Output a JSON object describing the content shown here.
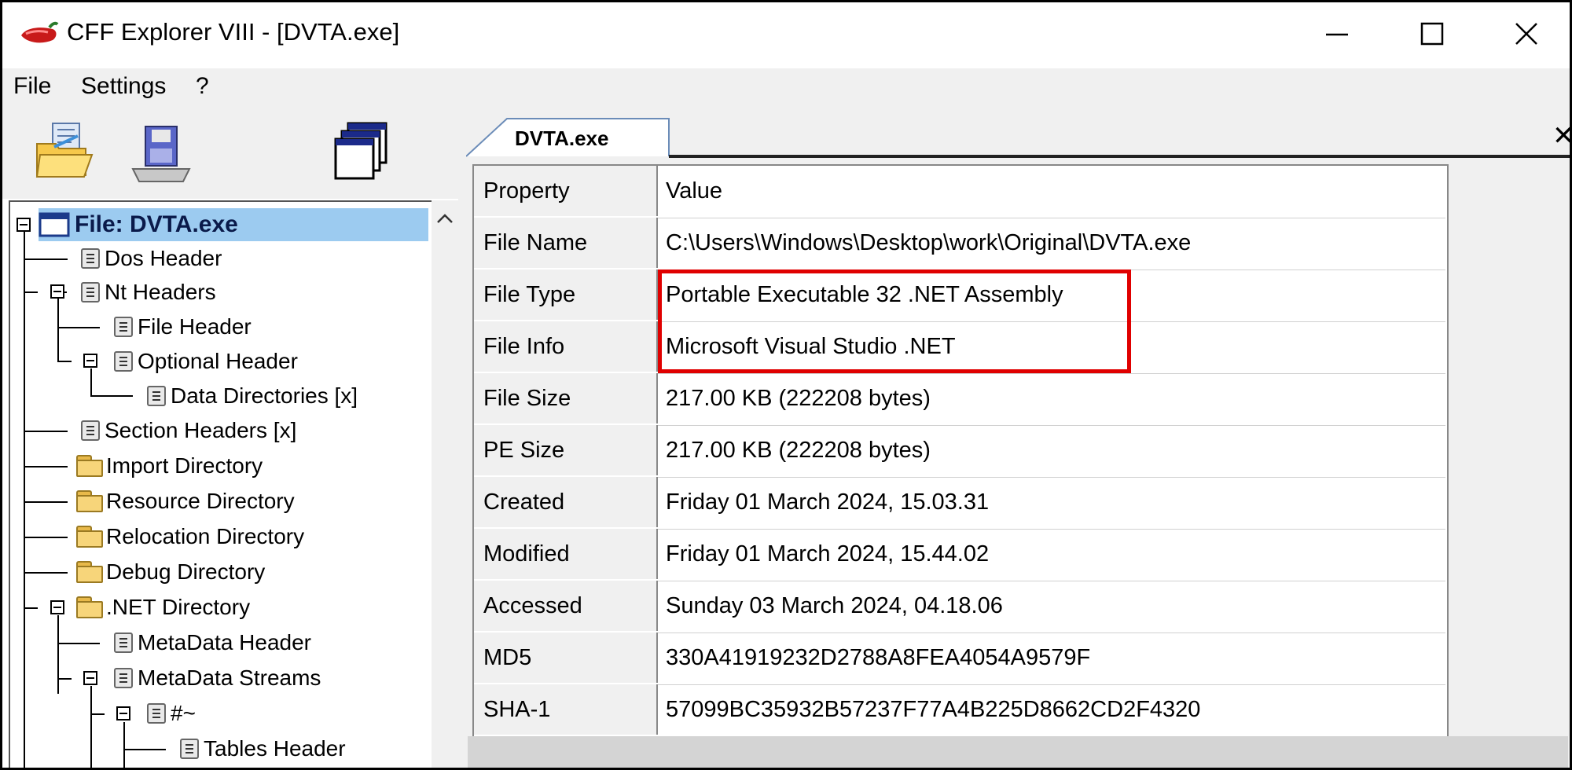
{
  "window": {
    "title": "CFF Explorer VIII - [DVTA.exe]"
  },
  "menubar": {
    "items": [
      "File",
      "Settings",
      "?"
    ]
  },
  "toolbar": {
    "open_icon": "open-folder-icon",
    "save_icon": "save-disk-icon",
    "windows_icon": "windows-cascade-icon"
  },
  "tree": {
    "root": "File: DVTA.exe",
    "items": [
      "Dos Header",
      "Nt Headers",
      "File Header",
      "Optional Header",
      "Data Directories [x]",
      "Section Headers [x]",
      "Import Directory",
      "Resource Directory",
      "Relocation Directory",
      "Debug Directory",
      ".NET Directory",
      "MetaData Header",
      "MetaData Streams",
      "#~",
      "Tables Header"
    ]
  },
  "tabs": {
    "active": "DVTA.exe"
  },
  "table": {
    "headers": [
      "Property",
      "Value"
    ],
    "rows": [
      [
        "File Name",
        "C:\\Users\\Windows\\Desktop\\work\\Original\\DVTA.exe"
      ],
      [
        "File Type",
        "Portable Executable 32 .NET Assembly"
      ],
      [
        "File Info",
        "Microsoft Visual Studio .NET"
      ],
      [
        "File Size",
        "217.00 KB (222208 bytes)"
      ],
      [
        "PE Size",
        "217.00 KB (222208 bytes)"
      ],
      [
        "Created",
        "Friday 01 March 2024, 15.03.31"
      ],
      [
        "Modified",
        "Friday 01 March 2024, 15.44.02"
      ],
      [
        "Accessed",
        "Sunday 03 March 2024, 04.18.06"
      ],
      [
        "MD5",
        "330A41919232D2788A8FEA4054A9579F"
      ],
      [
        "SHA-1",
        "57099BC35932B57237F77A4B225D8662CD2F4320"
      ]
    ]
  },
  "colors": {
    "highlight": "#e00000",
    "selection": "#9ccbf0"
  }
}
